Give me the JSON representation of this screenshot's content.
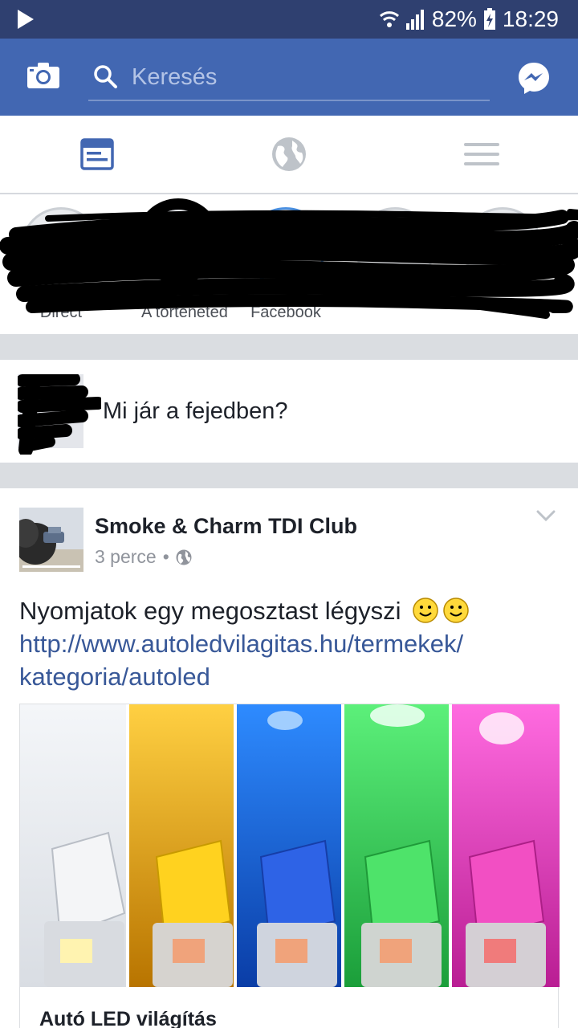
{
  "status_bar": {
    "battery": "82%",
    "time": "18:29"
  },
  "header": {
    "search_placeholder": "Keresés"
  },
  "stories": [
    {
      "label": "Direct"
    },
    {
      "label": "A történeted"
    },
    {
      "label": "Facebook"
    },
    {
      "label": ""
    },
    {
      "label": ""
    }
  ],
  "composer": {
    "prompt": "Mi jár a fejedben?"
  },
  "post": {
    "author": "Smoke & Charm TDI Club",
    "time": "3 perce",
    "separator": "•",
    "text": "Nyomjatok egy megosztast légyszi",
    "link_line1": "http://www.autoledvilagitas.hu/termekek/",
    "link_line2": "kategoria/autoled",
    "card_title": "Autó LED világítás"
  },
  "colors": {
    "status_bar": "#2f4070",
    "brand": "#4267b2",
    "link": "#385898",
    "led": [
      "#e8ecf2",
      "#f2b400",
      "#1f6fe0",
      "#2fcf52",
      "#e33fbd"
    ]
  }
}
